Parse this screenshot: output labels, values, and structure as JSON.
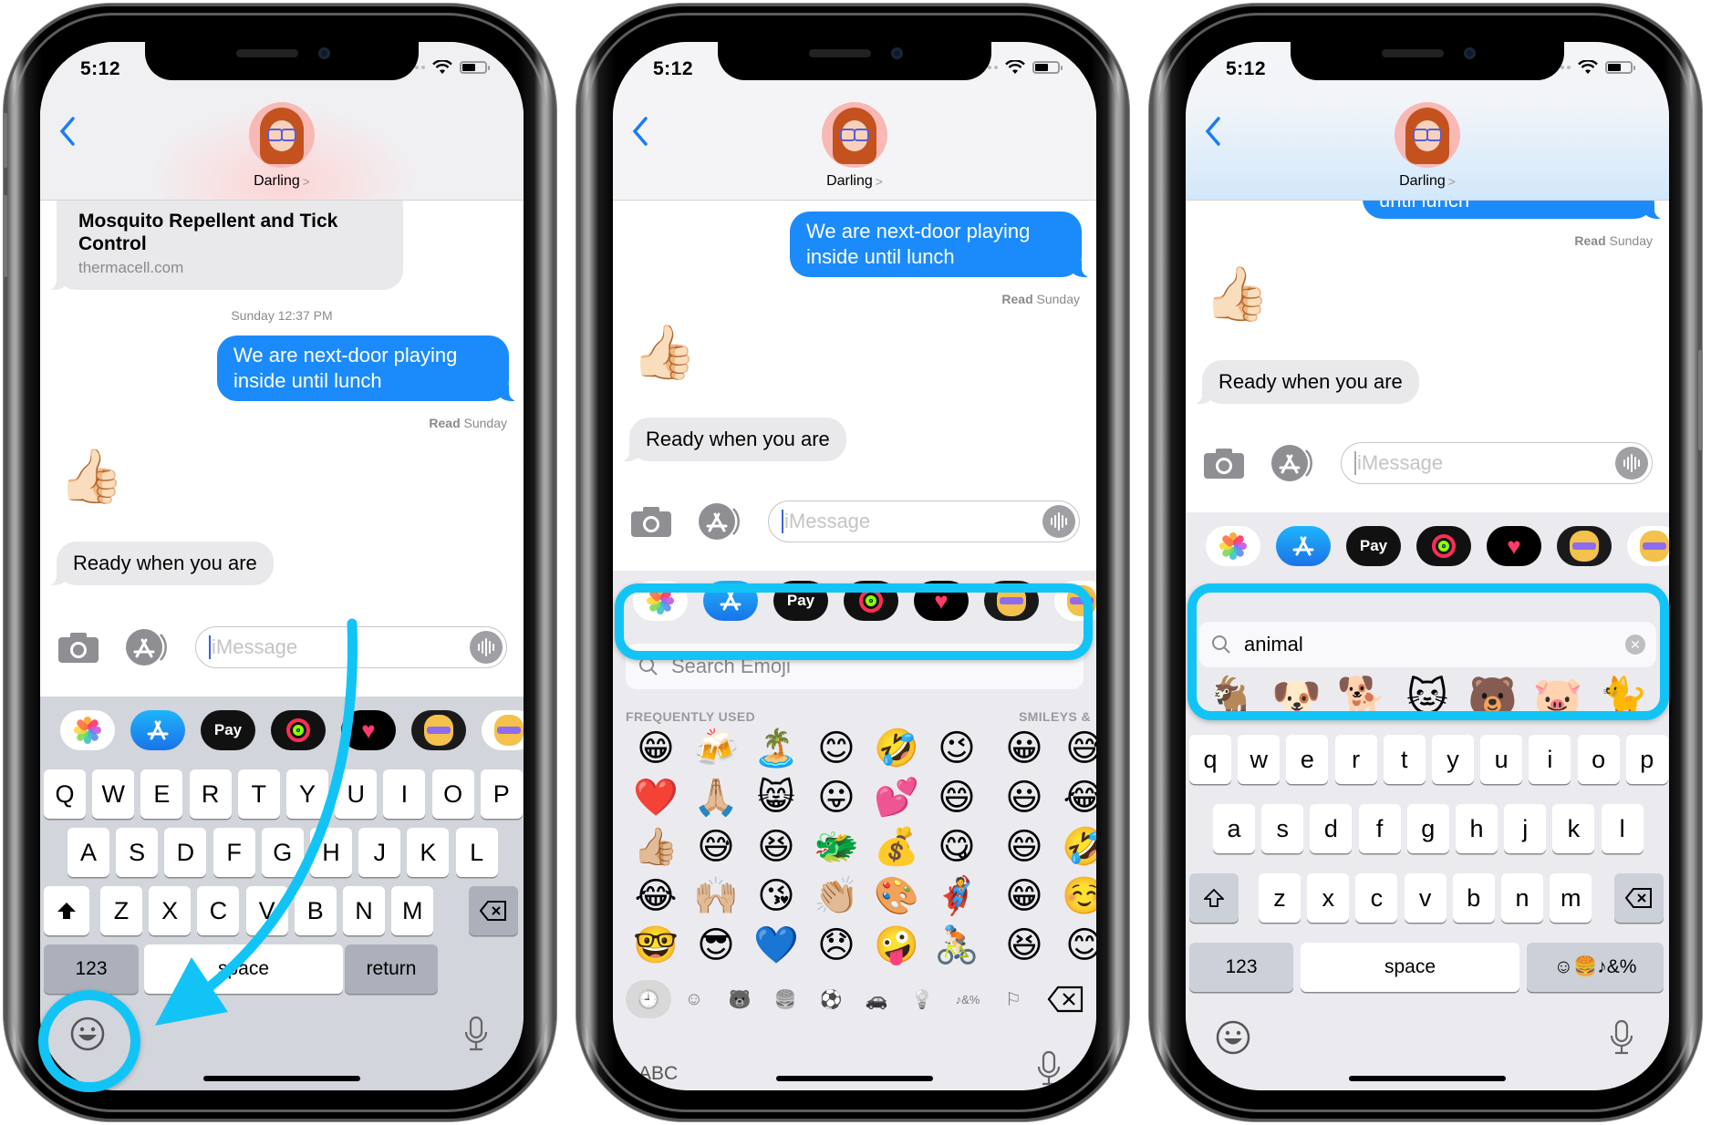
{
  "status": {
    "time": "5:12"
  },
  "header": {
    "contact_name": "Darling",
    "chevron": ">"
  },
  "phones": [
    {
      "state": "keyboard-alpha",
      "thread": {
        "link_preview": {
          "title": "Mosquito Repellent and Tick Control",
          "domain": "thermacell.com"
        },
        "timestamp": "Sunday 12:37 PM",
        "outgoing": "We are next-door playing inside until lunch",
        "read_label": "Read",
        "read_day": "Sunday",
        "reaction_emoji": "👍🏻",
        "incoming": "Ready when you are"
      },
      "input": {
        "placeholder": "iMessage"
      },
      "keyboard": {
        "row1": [
          "Q",
          "W",
          "E",
          "R",
          "T",
          "Y",
          "U",
          "I",
          "O",
          "P"
        ],
        "row2": [
          "A",
          "S",
          "D",
          "F",
          "G",
          "H",
          "J",
          "K",
          "L"
        ],
        "row3": [
          "Z",
          "X",
          "C",
          "V",
          "B",
          "N",
          "M"
        ],
        "numbers_label": "123",
        "space_label": "space",
        "return_label": "return"
      },
      "annotation": "arrow pointing to emoji keyboard button"
    },
    {
      "state": "emoji-keyboard",
      "thread": {
        "outgoing": "We are next-door playing inside until lunch",
        "read_label": "Read",
        "read_day": "Sunday",
        "reaction_emoji": "👍🏻",
        "incoming": "Ready when you are"
      },
      "input": {
        "placeholder": "iMessage"
      },
      "emoji_search": {
        "placeholder": "Search Emoji"
      },
      "sections": {
        "frequent": "FREQUENTLY USED",
        "smileys": "SMILEYS &"
      },
      "frequent_emojis": [
        "😁",
        "🍻",
        "🏝️",
        "😊",
        "🤣",
        "😉",
        "❤️",
        "🙏🏼",
        "😸",
        "😛",
        "💕",
        "😄",
        "👍🏼",
        "😅",
        "😆",
        "🐲",
        "💰",
        "😋",
        "😂",
        "🙌🏼",
        "😘",
        "👏🏼",
        "🎨",
        "🦸",
        "🤓",
        "😎",
        "💙",
        "😞",
        "🤪",
        "🚴🏻"
      ],
      "smiley_emojis": [
        "😀",
        "😅",
        "😃",
        "😂",
        "😄",
        "🤣",
        "😁",
        "☺️",
        "😆",
        "😊"
      ],
      "categories": [
        {
          "name": "recent",
          "glyph": "🕘"
        },
        {
          "name": "smileys",
          "glyph": "☺"
        },
        {
          "name": "animals",
          "glyph": "🐻"
        },
        {
          "name": "food",
          "glyph": "🍔"
        },
        {
          "name": "activity",
          "glyph": "⚽"
        },
        {
          "name": "travel",
          "glyph": "🚗"
        },
        {
          "name": "objects",
          "glyph": "💡"
        },
        {
          "name": "symbols",
          "glyph": "♪&%"
        },
        {
          "name": "flags",
          "glyph": "⚐"
        }
      ],
      "abc_label": "ABC"
    },
    {
      "state": "emoji-search",
      "thread": {
        "outgoing_partial": "until lunch",
        "read_label": "Read",
        "read_day": "Sunday",
        "reaction_emoji": "👍🏻",
        "incoming": "Ready when you are"
      },
      "input": {
        "placeholder": "iMessage"
      },
      "emoji_search": {
        "query": "animal"
      },
      "search_results": [
        "🐐",
        "🐶",
        "🐕",
        "🐱",
        "🐻",
        "🐷",
        "🐈"
      ],
      "keyboard": {
        "row1": [
          "q",
          "w",
          "e",
          "r",
          "t",
          "y",
          "u",
          "i",
          "o",
          "p"
        ],
        "row2": [
          "a",
          "s",
          "d",
          "f",
          "g",
          "h",
          "j",
          "k",
          "l"
        ],
        "row3": [
          "z",
          "x",
          "c",
          "v",
          "b",
          "n",
          "m"
        ],
        "numbers_label": "123",
        "space_label": "space",
        "emoji_categories_label": "☺🍔♪&%"
      }
    }
  ],
  "app_strip": [
    {
      "name": "photos",
      "label": ""
    },
    {
      "name": "app-store",
      "label": ""
    },
    {
      "name": "apple-pay",
      "label": "Pay"
    },
    {
      "name": "activity",
      "label": ""
    },
    {
      "name": "digital-touch",
      "label": ""
    },
    {
      "name": "memoji",
      "label": ""
    },
    {
      "name": "memoji-stickers",
      "label": ""
    }
  ],
  "colors": {
    "imessage_blue": "#1b8bfb",
    "annotation_cyan": "#12c4f6",
    "incoming_bubble": "#e9e9eb",
    "keyboard_bg": "#d2d5db"
  }
}
